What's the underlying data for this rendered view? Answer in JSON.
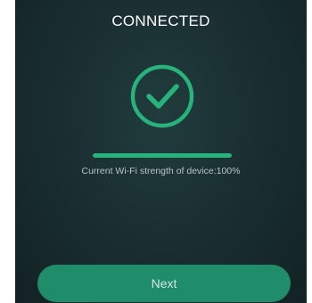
{
  "header": {
    "title": "CONNECTED"
  },
  "status": {
    "icon": "check-circle-icon",
    "accent_color": "#27b37b"
  },
  "wifi": {
    "strength_fraction": 1.0,
    "strength_text": "Current Wi-Fi strength of device:100%"
  },
  "footer": {
    "next_label": "Next",
    "button_color": "#1f8c6a"
  }
}
